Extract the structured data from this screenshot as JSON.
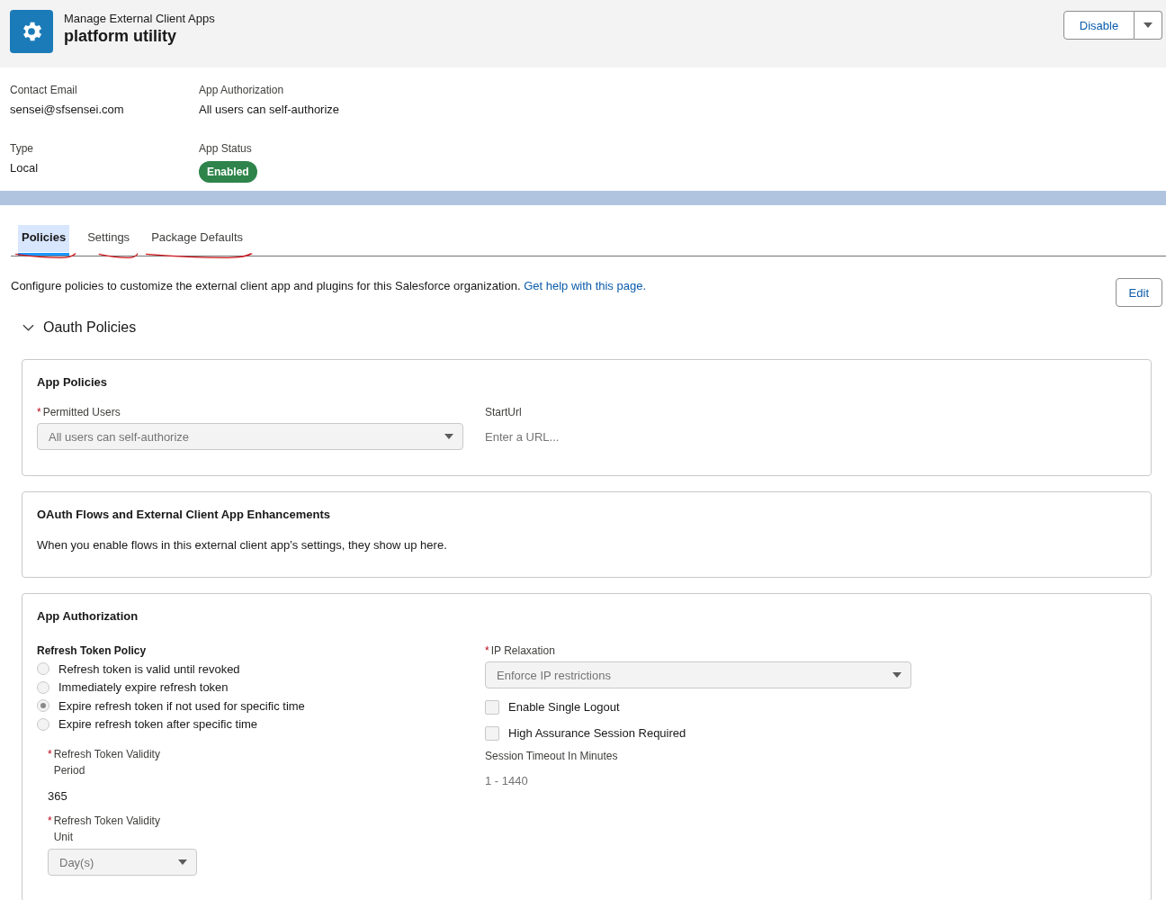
{
  "header": {
    "breadcrumb": "Manage External Client Apps",
    "title": "platform utility",
    "actions": [
      {
        "label": "Disable"
      }
    ]
  },
  "details": [
    {
      "label": "Contact Email",
      "value": "sensei@sfsensei.com",
      "kind": "text"
    },
    {
      "label": "App Authorization",
      "value": "All users can self-authorize",
      "kind": "text"
    },
    {
      "label": "Type",
      "value": "Local",
      "kind": "text"
    },
    {
      "label": "App Status",
      "value": "Enabled",
      "kind": "badge"
    }
  ],
  "tabs": [
    {
      "label": "Policies",
      "selected": true,
      "annotated": true
    },
    {
      "label": "Settings",
      "selected": false,
      "annotated": true
    },
    {
      "label": "Package Defaults",
      "selected": false,
      "annotated": true
    }
  ],
  "description": {
    "text": "Configure policies to customize the external client app and plugins for this Salesforce organization.",
    "link": "Get help with this page."
  },
  "edit_button": "Edit",
  "section": {
    "title": "Oauth Policies",
    "expanded": true
  },
  "app_policies": {
    "title": "App Policies",
    "permitted_users": {
      "label": "Permitted Users",
      "required_mark": "*",
      "value": "All users can self-authorize"
    },
    "start_url": {
      "label": "StartUrl",
      "placeholder": "Enter a URL..."
    }
  },
  "oauth_flows": {
    "title": "OAuth Flows and External Client App Enhancements",
    "text": "When you enable flows in this external client app’s settings, they show up here."
  },
  "app_authorization": {
    "title": "App Authorization",
    "refresh_policy_label": "Refresh Token Policy",
    "refresh_options": [
      {
        "label": "Refresh token is valid until revoked",
        "selected": false
      },
      {
        "label": "Immediately expire refresh token",
        "selected": false
      },
      {
        "label": "Expire refresh token if not used for specific time",
        "selected": true
      },
      {
        "label": "Expire refresh token after specific time",
        "selected": false
      }
    ],
    "period": {
      "label": "Refresh Token Validity Period",
      "required_mark": "*",
      "value": "365"
    },
    "unit": {
      "label": "Refresh Token Validity Unit",
      "required_mark": "*",
      "value": "Day(s)"
    },
    "ip_relaxation": {
      "label": "IP Relaxation",
      "required_mark": "*",
      "value": "Enforce IP restrictions"
    },
    "checkboxes": [
      {
        "label": "Enable Single Logout",
        "checked": false
      },
      {
        "label": "High Assurance Session Required",
        "checked": false
      }
    ],
    "timeout": {
      "label": "Session Timeout In Minutes",
      "placeholder": "1 - 1440"
    }
  }
}
